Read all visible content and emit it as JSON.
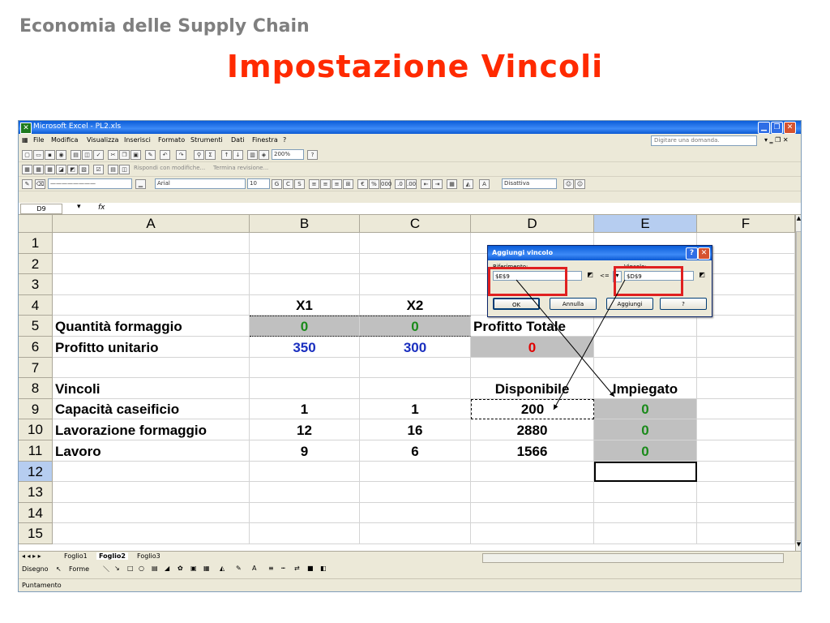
{
  "slide": {
    "header": "Economia delle Supply Chain",
    "title": "Impostazione Vincoli"
  },
  "window": {
    "title": "Microsoft Excel - PL2.xls",
    "menu": [
      "File",
      "Modifica",
      "Visualizza",
      "Inserisci",
      "Formato",
      "Strumenti",
      "Dati",
      "Finestra",
      "?"
    ],
    "help_placeholder": "Digitare una domanda.",
    "toolbar": {
      "zoom": "200%",
      "reply_text": "Rispondi con modifiche...",
      "end_review": "Termina revisione...",
      "font": "Arial",
      "size": "10",
      "style_box": "Disattiva"
    },
    "name_box": "D9",
    "fx": "fx"
  },
  "grid": {
    "columns": [
      "A",
      "B",
      "C",
      "D",
      "E",
      "F"
    ],
    "rows": [
      "1",
      "2",
      "3",
      "4",
      "5",
      "6",
      "7",
      "8",
      "9",
      "10",
      "11",
      "12",
      "13",
      "14",
      "15"
    ],
    "cells": {
      "b4": "X1",
      "c4": "X2",
      "a5": "Quantità formaggio",
      "b5": "0",
      "c5": "0",
      "d5": "Profitto Totale",
      "a6": "Profitto unitario",
      "b6": "350",
      "c6": "300",
      "d6": "0",
      "a8": "Vincoli",
      "d8": "Disponibile",
      "e8": "Impiegato",
      "a9": "Capacità caseificio",
      "b9": "1",
      "c9": "1",
      "d9": "200",
      "e9": "0",
      "a10": "Lavorazione formaggio",
      "b10": "12",
      "c10": "16",
      "d10": "2880",
      "e10": "0",
      "a11": "Lavoro",
      "b11": "9",
      "c11": "6",
      "d11": "1566",
      "e11": "0"
    }
  },
  "sheets": [
    "Foglio1",
    "Foglio2",
    "Foglio3"
  ],
  "active_sheet": "Foglio2",
  "drawbar": {
    "draw": "Disegno",
    "shapes": "Forme"
  },
  "status": "Puntamento",
  "dialog": {
    "title": "Aggiungi vincolo",
    "ref_label": "Riferimento:",
    "ref_value": "$E$9",
    "operator": "<=",
    "constraint_label": "Vincolo:",
    "constraint_value": "$D$9",
    "ok": "OK",
    "cancel": "Annulla",
    "add": "Aggiungi",
    "help": "?"
  },
  "colors": {
    "title_red": "#ff2a00",
    "green_value": "#1a8a1a",
    "blue_value": "#1a2fbf",
    "red_value": "#e00000",
    "highlight_box": "#e02020"
  }
}
